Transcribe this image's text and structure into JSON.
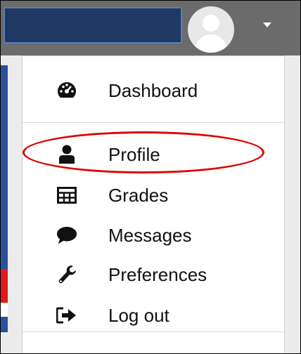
{
  "header": {
    "user_menu_caret": "caret-down-icon"
  },
  "menu": {
    "items": [
      {
        "label": "Dashboard",
        "icon": "dashboard-icon"
      },
      {
        "label": "Profile",
        "icon": "user-icon"
      },
      {
        "label": "Grades",
        "icon": "table-icon"
      },
      {
        "label": "Messages",
        "icon": "comment-icon"
      },
      {
        "label": "Preferences",
        "icon": "wrench-icon"
      },
      {
        "label": "Log out",
        "icon": "sign-out-icon"
      }
    ]
  },
  "colors": {
    "navbar": "#6b6b6b",
    "accent_left": "#2b4f9b",
    "annotation": "#e00000"
  }
}
